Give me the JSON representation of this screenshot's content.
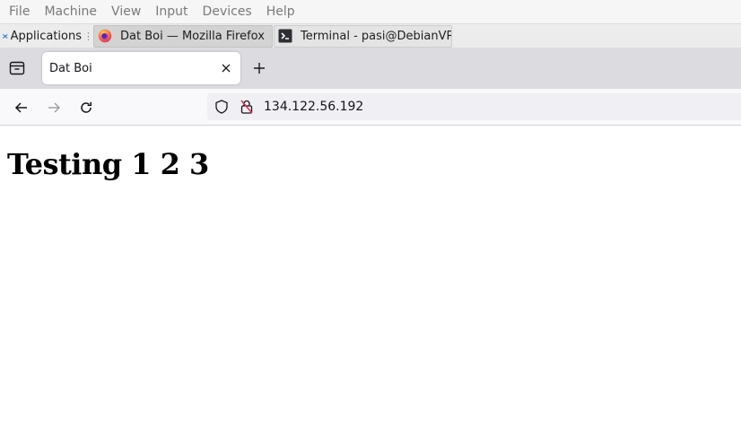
{
  "host_menu": {
    "items": [
      "File",
      "Machine",
      "View",
      "Input",
      "Devices",
      "Help"
    ]
  },
  "taskbar": {
    "applications_label": "Applications",
    "tasks": [
      {
        "label": "Dat Boi — Mozilla Firefox",
        "icon": "firefox-icon",
        "active": true
      },
      {
        "label": "Terminal - pasi@DebianVP...",
        "icon": "terminal-icon",
        "active": false
      }
    ]
  },
  "browser": {
    "tab": {
      "title": "Dat Boi"
    },
    "url": "134.122.56.192",
    "accent": "#ffffff"
  },
  "page": {
    "heading": "Testing 1 2 3"
  }
}
